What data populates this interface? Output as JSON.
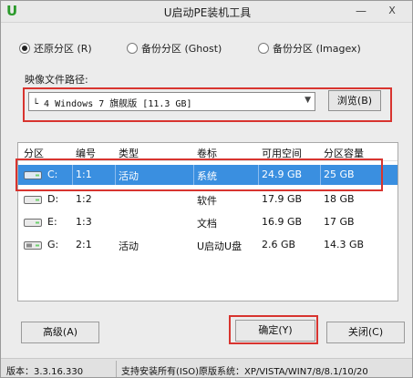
{
  "window": {
    "title": "U启动PE装机工具",
    "logo": "U",
    "minimize": "—",
    "close": "X"
  },
  "modes": [
    {
      "label": "还原分区 (R)",
      "checked": true
    },
    {
      "label": "备份分区 (Ghost)",
      "checked": false
    },
    {
      "label": "备份分区 (Imagex)",
      "checked": false
    }
  ],
  "image_path": {
    "label": "映像文件路径:",
    "selected": "└ 4 Windows 7 旗舰版 [11.3 GB]",
    "browse_label": "浏览(B)"
  },
  "partition_table": {
    "columns": [
      "分区",
      "编号",
      "类型",
      "卷标",
      "可用空间",
      "分区容量"
    ],
    "rows": [
      {
        "drive": "C:",
        "num": "1:1",
        "type": "活动",
        "label": "系统",
        "free": "24.9 GB",
        "size": "25 GB",
        "selected": true
      },
      {
        "drive": "D:",
        "num": "1:2",
        "type": "",
        "label": "软件",
        "free": "17.9 GB",
        "size": "18 GB",
        "selected": false
      },
      {
        "drive": "E:",
        "num": "1:3",
        "type": "",
        "label": "文档",
        "free": "16.9 GB",
        "size": "17 GB",
        "selected": false
      },
      {
        "drive": "G:",
        "num": "2:1",
        "type": "活动",
        "label": "U启动U盘",
        "free": "2.6 GB",
        "size": "14.3 GB",
        "selected": false
      }
    ]
  },
  "buttons": {
    "advanced": "高级(A)",
    "ok": "确定(Y)",
    "close": "关闭(C)"
  },
  "status": {
    "version": "版本：3.3.16.330",
    "support": "支持安装所有(ISO)原版系统：XP/VISTA/WIN7/8/8.1/10/20"
  },
  "colors": {
    "selection": "#3a8fe0",
    "highlight": "#d8342f",
    "logo": "#2b9a2b"
  }
}
